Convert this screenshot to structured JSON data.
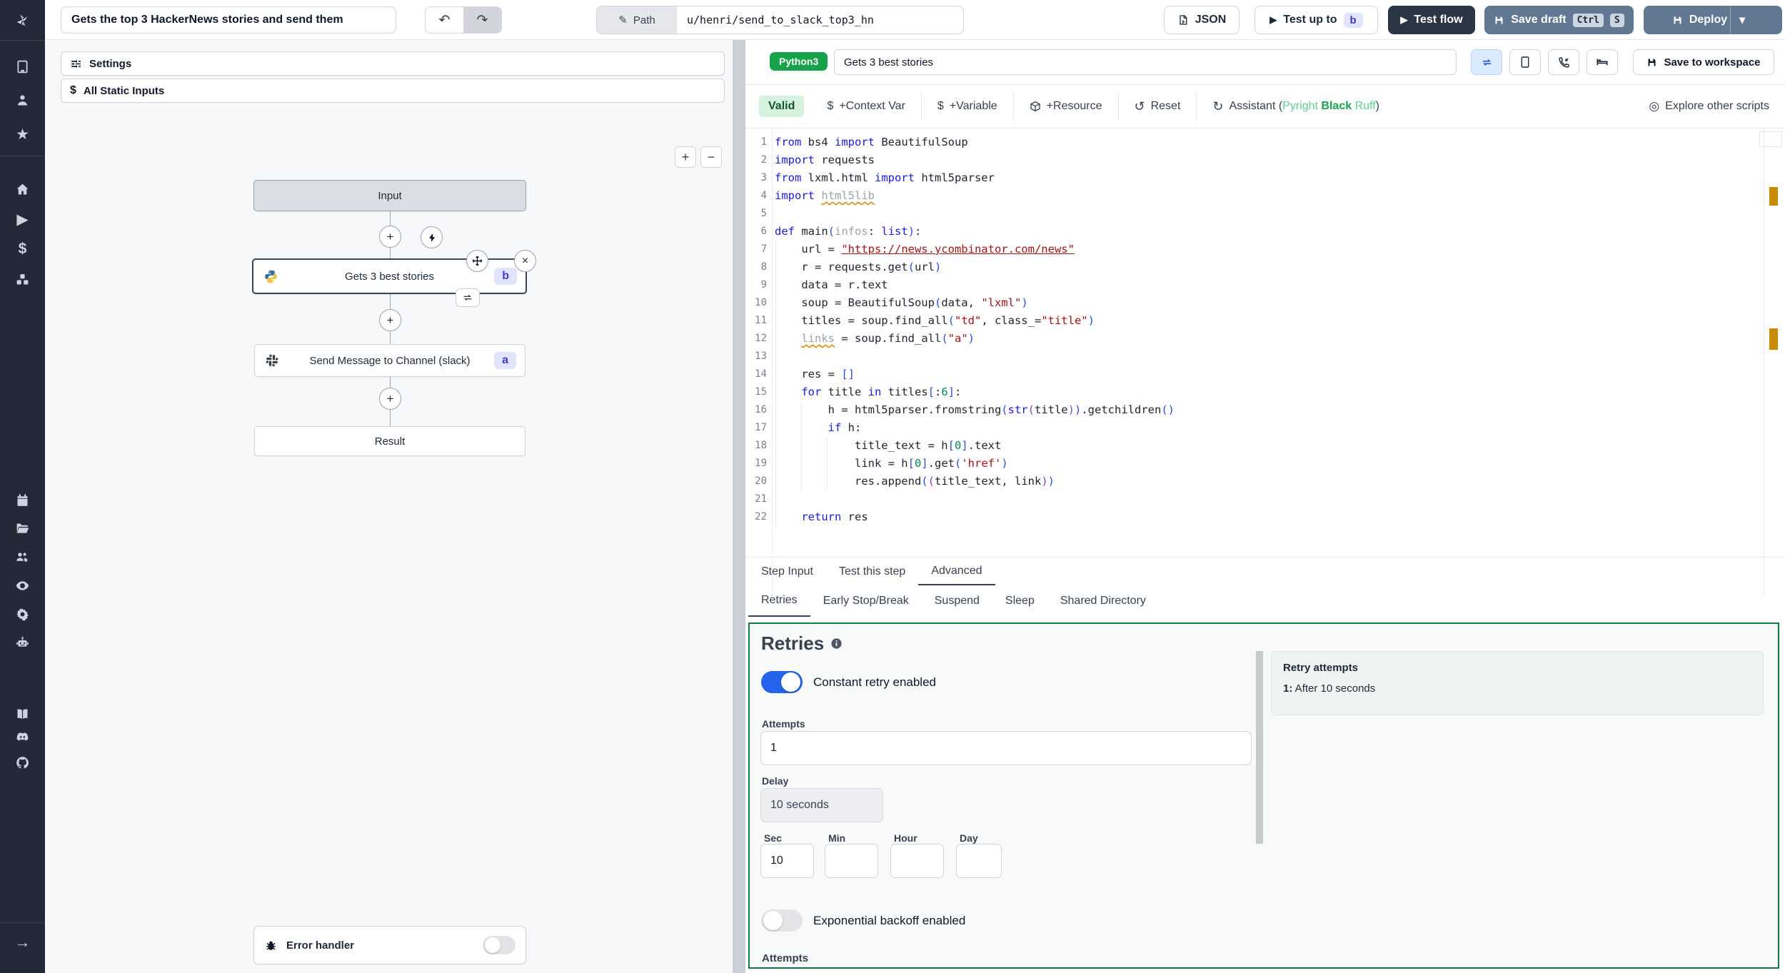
{
  "topbar": {
    "flow_title": "Gets the top 3 HackerNews stories and send them",
    "path_label": "Path",
    "path_value": "u/henri/send_to_slack_top3_hn",
    "json_label": "JSON",
    "test_up_to_label": "Test up to",
    "test_up_to_badge": "b",
    "test_flow_label": "Test flow",
    "save_draft_label": "Save draft",
    "save_kbd_ctrl": "Ctrl",
    "save_kbd_s": "S",
    "deploy_label": "Deploy"
  },
  "icons": {
    "undo": "↶",
    "redo": "↷",
    "pencil": "✎",
    "play": "▶",
    "chevron_down": "▾",
    "dollar": "$",
    "plus": "+",
    "minus": "−",
    "reset": "↺",
    "assistant": "↻",
    "explore": "◎",
    "star": "★",
    "arrow_right": "→",
    "close": "×"
  },
  "flow_panel": {
    "settings_label": "Settings",
    "static_inputs_label": "All Static Inputs",
    "nodes": {
      "input": "Input",
      "step_b_label": "Gets 3 best stories",
      "step_b_badge": "b",
      "step_a_label": "Send Message to Channel (slack)",
      "step_a_badge": "a",
      "result": "Result",
      "error_handler": "Error handler"
    }
  },
  "editor": {
    "lang_badge": "Python3",
    "step_name": "Gets 3 best stories",
    "save_to_workspace": "Save to workspace",
    "toolbar": {
      "valid": "Valid",
      "context_var": "+Context Var",
      "variable": "+Variable",
      "resource": "+Resource",
      "reset": "Reset",
      "assistant_prefix": "Assistant (",
      "assistant_pyright": "Pyright",
      "assistant_black": "Black",
      "assistant_ruff": "Ruff",
      "assistant_suffix": ")",
      "explore": "Explore other scripts"
    },
    "code_lines": [
      [
        [
          "k",
          "from"
        ],
        [
          "p",
          " bs4 "
        ],
        [
          "k",
          "import"
        ],
        [
          "p",
          " BeautifulSoup"
        ]
      ],
      [
        [
          "k",
          "import"
        ],
        [
          "p",
          " requests"
        ]
      ],
      [
        [
          "k",
          "from"
        ],
        [
          "p",
          " lxml.html "
        ],
        [
          "k",
          "import"
        ],
        [
          "p",
          " html5parser"
        ]
      ],
      [
        [
          "k",
          "import"
        ],
        [
          "p",
          " "
        ],
        [
          "w",
          "html5lib"
        ]
      ],
      [],
      [
        [
          "k",
          "def"
        ],
        [
          "p",
          " main"
        ],
        [
          "b1",
          "("
        ],
        [
          "g",
          "infos"
        ],
        [
          "p",
          ": "
        ],
        [
          "k",
          "list"
        ],
        [
          "b1",
          ")"
        ],
        [
          "p",
          ":"
        ]
      ],
      [
        [
          "p",
          "    url = "
        ],
        [
          "su",
          "\"https://news.ycombinator.com/news\""
        ]
      ],
      [
        [
          "p",
          "    r = requests.get"
        ],
        [
          "b1",
          "("
        ],
        [
          "p",
          "url"
        ],
        [
          "b1",
          ")"
        ]
      ],
      [
        [
          "p",
          "    data = r.text"
        ]
      ],
      [
        [
          "p",
          "    soup = BeautifulSoup"
        ],
        [
          "b1",
          "("
        ],
        [
          "p",
          "data, "
        ],
        [
          "s",
          "\"lxml\""
        ],
        [
          "b1",
          ")"
        ]
      ],
      [
        [
          "p",
          "    titles = soup.find_all"
        ],
        [
          "b1",
          "("
        ],
        [
          "s",
          "\"td\""
        ],
        [
          "p",
          ", class_="
        ],
        [
          "s",
          "\"title\""
        ],
        [
          "b1",
          ")"
        ]
      ],
      [
        [
          "p",
          "    "
        ],
        [
          "w",
          "links"
        ],
        [
          "p",
          " = soup.find_all"
        ],
        [
          "b1",
          "("
        ],
        [
          "s",
          "\"a\""
        ],
        [
          "b1",
          ")"
        ]
      ],
      [],
      [
        [
          "p",
          "    res = "
        ],
        [
          "b1",
          "[]"
        ]
      ],
      [
        [
          "p",
          "    "
        ],
        [
          "k",
          "for"
        ],
        [
          "p",
          " title "
        ],
        [
          "k",
          "in"
        ],
        [
          "p",
          " titles"
        ],
        [
          "b1",
          "["
        ],
        [
          "p",
          ":"
        ],
        [
          "n",
          "6"
        ],
        [
          "b1",
          "]"
        ],
        [
          "p",
          ":"
        ]
      ],
      [
        [
          "p",
          "        h = html5parser.fromstring"
        ],
        [
          "b1",
          "("
        ],
        [
          "k",
          "str"
        ],
        [
          "b2",
          "("
        ],
        [
          "p",
          "title"
        ],
        [
          "b2",
          ")"
        ],
        [
          "b1",
          ")"
        ],
        [
          "p",
          ".getchildren"
        ],
        [
          "b1",
          "()"
        ]
      ],
      [
        [
          "p",
          "        "
        ],
        [
          "k",
          "if"
        ],
        [
          "p",
          " h:"
        ]
      ],
      [
        [
          "p",
          "            title_text = h"
        ],
        [
          "b1",
          "["
        ],
        [
          "n",
          "0"
        ],
        [
          "b1",
          "]"
        ],
        [
          "p",
          ".text"
        ]
      ],
      [
        [
          "p",
          "            link = h"
        ],
        [
          "b1",
          "["
        ],
        [
          "n",
          "0"
        ],
        [
          "b1",
          "]"
        ],
        [
          "p",
          ".get"
        ],
        [
          "b1",
          "("
        ],
        [
          "s",
          "'href'"
        ],
        [
          "b1",
          ")"
        ]
      ],
      [
        [
          "p",
          "            res.append"
        ],
        [
          "b1",
          "("
        ],
        [
          "b2",
          "("
        ],
        [
          "p",
          "title_text, link"
        ],
        [
          "b2",
          ")"
        ],
        [
          "b1",
          ")"
        ]
      ],
      [],
      [
        [
          "p",
          "    "
        ],
        [
          "k",
          "return"
        ],
        [
          "p",
          " res"
        ]
      ]
    ]
  },
  "tabs": {
    "step_input": "Step Input",
    "test_this_step": "Test this step",
    "advanced": "Advanced"
  },
  "subtabs": {
    "retries": "Retries",
    "early_stop": "Early Stop/Break",
    "suspend": "Suspend",
    "sleep": "Sleep",
    "shared_directory": "Shared Directory"
  },
  "retries": {
    "title": "Retries",
    "constant_label": "Constant retry enabled",
    "attempts_label": "Attempts",
    "attempts_value": "1",
    "delay_label": "Delay",
    "delay_value": "10 seconds",
    "sec_label": "Sec",
    "sec_value": "10",
    "min_label": "Min",
    "hour_label": "Hour",
    "day_label": "Day",
    "exponential_label": "Exponential backoff enabled",
    "attempts2_label": "Attempts",
    "summary_title": "Retry attempts",
    "summary_bold": "1:",
    "summary_rest": " After 10 seconds"
  },
  "colors": {
    "accent_blue": "#2563eb",
    "badge_indigo": "#4338ca",
    "python_green": "#17a34a",
    "panel_green": "#0e7a3d",
    "warning_orange": "#c98a04",
    "slate_button": "#627892",
    "dark_button": "#2b3645",
    "sidebar_dark": "#232936"
  }
}
